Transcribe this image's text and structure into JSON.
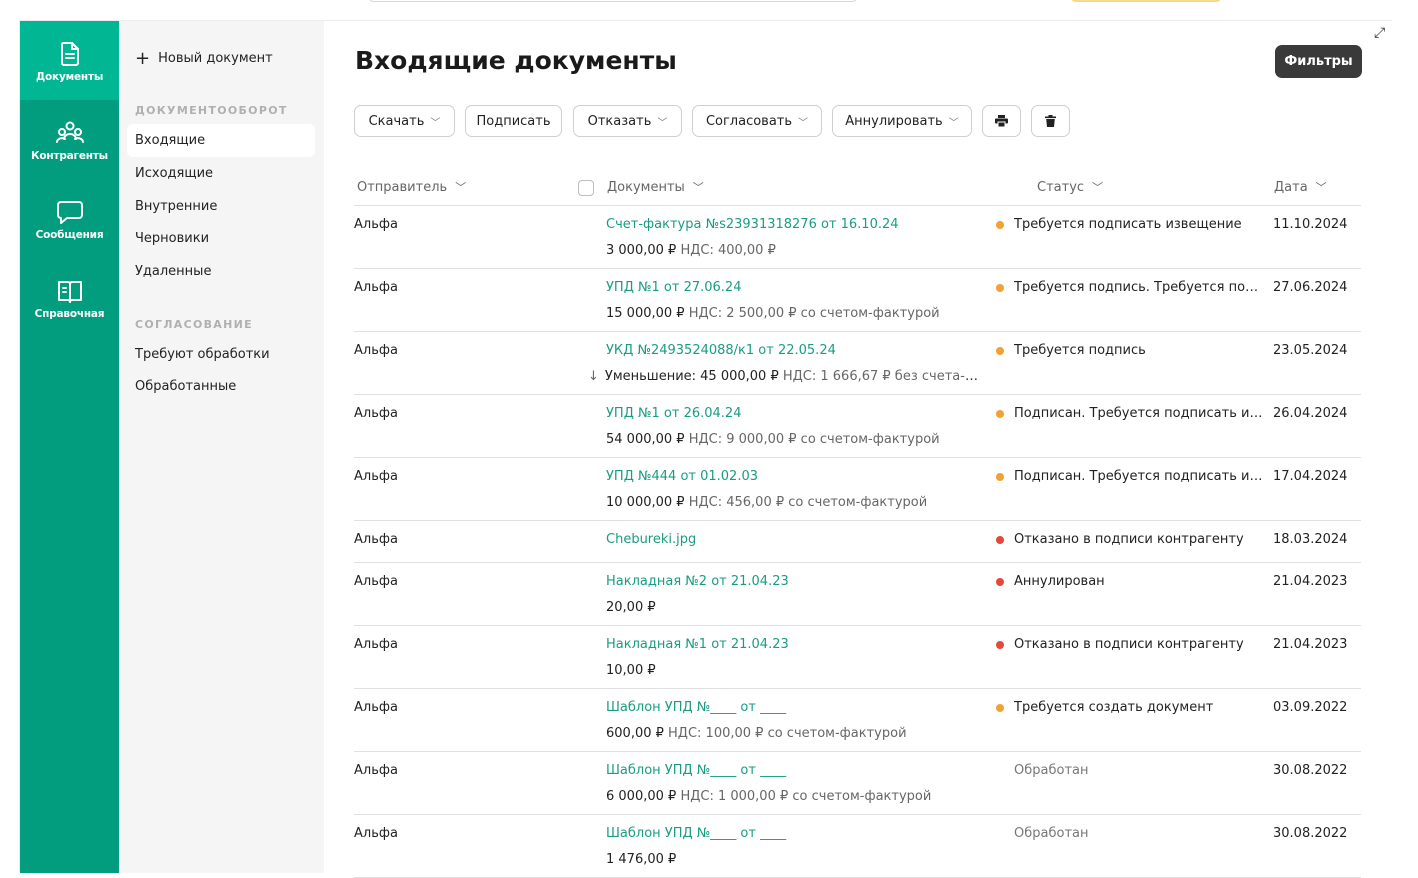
{
  "rail": [
    {
      "name": "rail-item-documents",
      "icon": "document-icon",
      "label": "Документы",
      "active": true
    },
    {
      "name": "rail-item-contractors",
      "icon": "people-icon",
      "label": "Контрагенты",
      "active": false
    },
    {
      "name": "rail-item-messages",
      "icon": "chat-icon",
      "label": "Сообщения",
      "active": false
    },
    {
      "name": "rail-item-reference",
      "icon": "book-icon",
      "label": "Справочная",
      "active": false
    }
  ],
  "subnav": {
    "new_doc": "Новый документ",
    "section1": "ДОКУМЕНТООБОРОТ",
    "items1": [
      "Входящие",
      "Исходящие",
      "Внутренние",
      "Черновики",
      "Удаленные"
    ],
    "section2": "СОГЛАСОВАНИЕ",
    "items2": [
      "Требуют обработки",
      "Обработанные"
    ]
  },
  "main": {
    "title": "Входящие документы",
    "filters": "Фильтры",
    "toolbar": {
      "download": "Скачать",
      "sign": "Подписать",
      "reject": "Отказать",
      "approve": "Согласовать",
      "cancel": "Аннулировать"
    },
    "columns": {
      "sender": "Отправитель",
      "documents": "Документы",
      "status": "Статус",
      "date": "Дата"
    }
  },
  "colors": {
    "accent": "#029d7f",
    "link": "#1a9c83",
    "orange": "#f2a134",
    "red": "#e5473b"
  },
  "rows": [
    {
      "sender": "Альфа",
      "doc": "Счет-фактура №s23931318276 от 16.10.24",
      "amount": "3 000,00 ₽",
      "extra": "НДС: 400,00 ₽",
      "status": "Требуется подписать извещение",
      "status_color": "orange",
      "date": "11.10.2024"
    },
    {
      "sender": "Альфа",
      "doc": "УПД №1 от 27.06.24",
      "amount": "15 000,00 ₽",
      "extra": "НДС: 2 500,00 ₽ со счетом-фактурой",
      "status": "Требуется подпись. Требуется подп...",
      "status_color": "orange",
      "date": "27.06.2024"
    },
    {
      "sender": "Альфа",
      "doc": "УКД №2493524088/к1 от 22.05.24",
      "amount": "Уменьшение: 45 000,00 ₽",
      "extra": "НДС: 1 666,67 ₽ без счета-фак...",
      "status": "Требуется подпись",
      "status_color": "orange",
      "date": "23.05.2024",
      "arrow": "↓"
    },
    {
      "sender": "Альфа",
      "doc": "УПД №1 от 26.04.24",
      "amount": "54 000,00 ₽",
      "extra": "НДС: 9 000,00 ₽ со счетом-фактурой",
      "status": "Подписан. Требуется подписать из...",
      "status_color": "orange",
      "date": "26.04.2024"
    },
    {
      "sender": "Альфа",
      "doc": "УПД №444 от 01.02.03",
      "amount": "10 000,00 ₽",
      "extra": "НДС: 456,00 ₽ со счетом-фактурой",
      "status": "Подписан. Требуется подписать из...",
      "status_color": "orange",
      "date": "17.04.2024"
    },
    {
      "sender": "Альфа",
      "doc": "Chebureki.jpg",
      "amount": "",
      "extra": "",
      "status": "Отказано в подписи контрагенту",
      "status_color": "red",
      "date": "18.03.2024",
      "short": true
    },
    {
      "sender": "Альфа",
      "doc": "Накладная №2 от 21.04.23",
      "amount": "20,00 ₽",
      "extra": "",
      "status": "Аннулирован",
      "status_color": "red",
      "date": "21.04.2023"
    },
    {
      "sender": "Альфа",
      "doc": "Накладная №1 от 21.04.23",
      "amount": "10,00 ₽",
      "extra": "",
      "status": "Отказано в подписи контрагенту",
      "status_color": "red",
      "date": "21.04.2023"
    },
    {
      "sender": "Альфа",
      "doc": "Шаблон УПД №____ от ____",
      "amount": "600,00 ₽",
      "extra": "НДС: 100,00 ₽ со счетом-фактурой",
      "status": "Требуется создать документ",
      "status_color": "orange",
      "date": "03.09.2022"
    },
    {
      "sender": "Альфа",
      "doc": "Шаблон УПД №____ от ____",
      "amount": "6 000,00 ₽",
      "extra": "НДС: 1 000,00 ₽ со счетом-фактурой",
      "status": "Обработан",
      "status_color": "none",
      "date": "30.08.2022"
    },
    {
      "sender": "Альфа",
      "doc": "Шаблон УПД №____ от ____",
      "amount": "1 476,00 ₽",
      "extra": "",
      "status": "Обработан",
      "status_color": "none",
      "date": "30.08.2022"
    }
  ]
}
